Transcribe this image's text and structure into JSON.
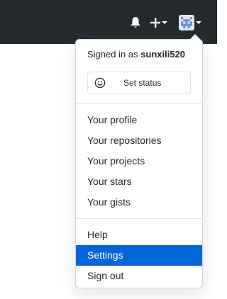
{
  "header": {
    "bell_icon": "bell-icon",
    "plus_icon": "plus-icon",
    "avatar_icon": "user-avatar-identicon"
  },
  "menu": {
    "signed_in_prefix": "Signed in as ",
    "username": "sunxili520",
    "set_status_label": "Set status",
    "set_status_icon": "smiley-icon",
    "group1": [
      "Your profile",
      "Your repositories",
      "Your projects",
      "Your stars",
      "Your gists"
    ],
    "group2": [
      "Help",
      "Settings",
      "Sign out"
    ],
    "active_item": "Settings"
  },
  "colors": {
    "header_bg": "#24292e",
    "active_bg": "#0366d6"
  }
}
